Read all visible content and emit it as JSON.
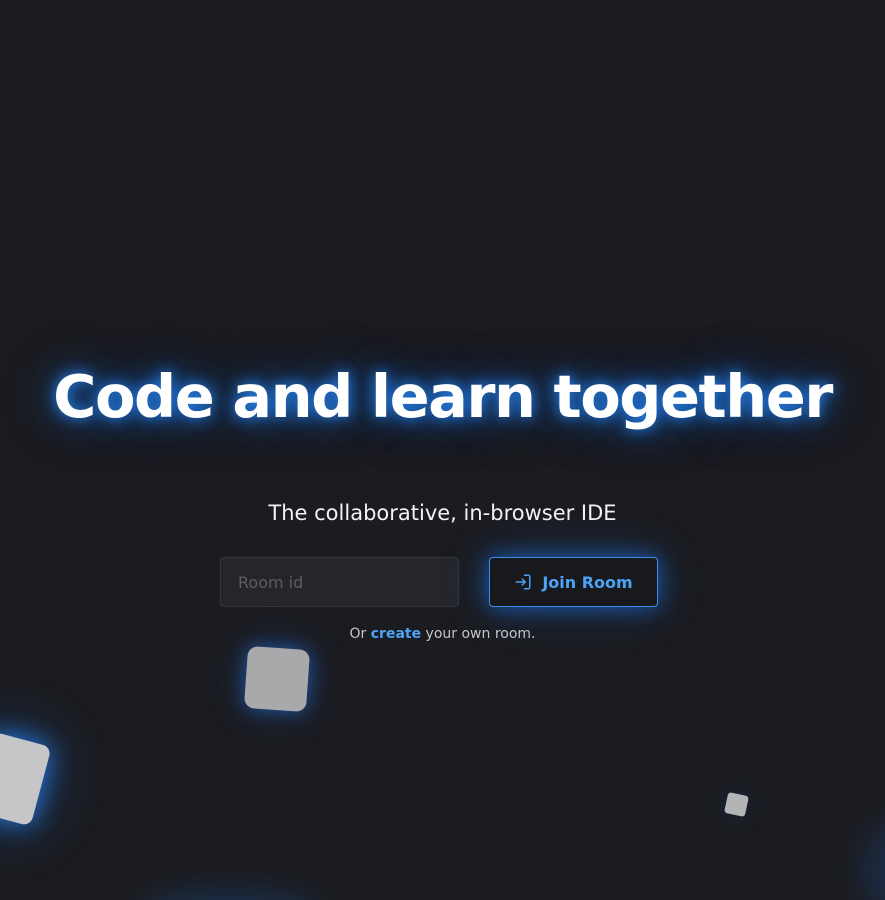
{
  "hero": {
    "title": "Code and learn together",
    "subtitle": "The collaborative, in-browser IDE"
  },
  "join": {
    "input_placeholder": "Room id",
    "input_value": "",
    "button_label": "Join Room",
    "button_icon": "login-arrow-icon"
  },
  "hint": {
    "prefix": "Or",
    "link_label": "create",
    "suffix": "your own room."
  },
  "colors": {
    "background": "#1b1c20",
    "accent": "#4da3f5",
    "glow": "#1e78f0"
  }
}
